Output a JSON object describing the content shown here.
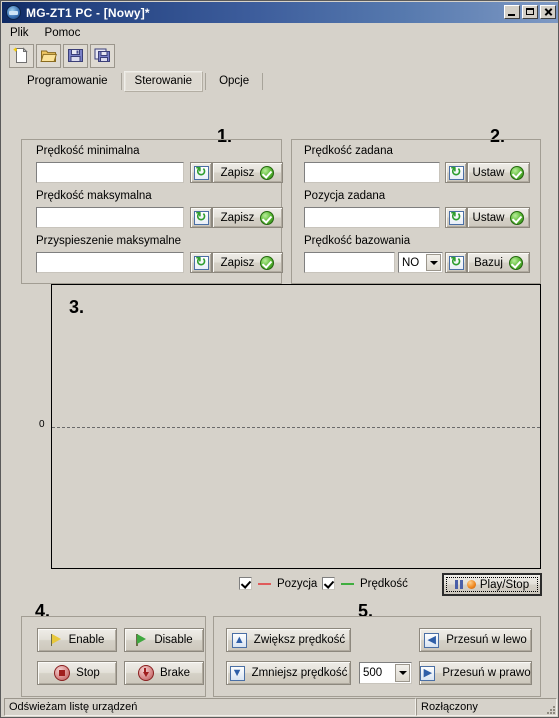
{
  "window": {
    "title": "MG-ZT1 PC  -  [Nowy]*",
    "icon": "app-logo-icon",
    "controls": {
      "minimize": "minimize-icon",
      "maximize": "maximize-icon",
      "close": "close-icon"
    }
  },
  "menu": {
    "items": [
      "Plik",
      "Pomoc"
    ]
  },
  "toolbar": {
    "buttons": [
      {
        "name": "new-file-icon",
        "tooltip": "Nowy"
      },
      {
        "name": "open-file-icon",
        "tooltip": "Otwórz"
      },
      {
        "name": "save-file-icon",
        "tooltip": "Zapisz"
      },
      {
        "name": "save-as-file-icon",
        "tooltip": "Zapisz jako"
      }
    ]
  },
  "tabs": [
    {
      "label": "Programowanie",
      "active": false
    },
    {
      "label": "Sterowanie",
      "active": true
    },
    {
      "label": "Opcje",
      "active": false
    }
  ],
  "group1": {
    "number": "1.",
    "fields": [
      {
        "label": "Prędkość minimalna",
        "value": "",
        "button": "Zapisz"
      },
      {
        "label": "Prędkość maksymalna",
        "value": "",
        "button": "Zapisz"
      },
      {
        "label": "Przyspieszenie maksymalne",
        "value": "",
        "button": "Zapisz"
      }
    ]
  },
  "group2": {
    "number": "2.",
    "fields": [
      {
        "label": "Prędkość zadana",
        "value": "",
        "button": "Ustaw"
      },
      {
        "label": "Pozycja zadana",
        "value": "",
        "button": "Ustaw"
      },
      {
        "label": "Prędkość bazowania",
        "value": "",
        "button": "Bazuj",
        "combo": "NO"
      }
    ]
  },
  "chart": {
    "number": "3.",
    "zero_label": "0"
  },
  "chart_data": {
    "type": "line",
    "title": "",
    "xlabel": "",
    "ylabel": "",
    "grid": true,
    "legend_position": "bottom",
    "yticks": [
      "0"
    ],
    "series": [
      {
        "name": "Pozycja",
        "color": "#e05b5b",
        "visible": true,
        "x": [],
        "values": []
      },
      {
        "name": "Prędkość",
        "color": "#3fae3f",
        "visible": true,
        "x": [],
        "values": []
      }
    ]
  },
  "legend": {
    "items": [
      {
        "label": "Pozycja",
        "color": "#e05b5b",
        "checked": true
      },
      {
        "label": "Prędkość",
        "color": "#3fae3f",
        "checked": true
      }
    ],
    "play_stop": "Play/Stop"
  },
  "group4": {
    "number": "4.",
    "buttons": [
      {
        "label": "Enable",
        "icon": "flag-yellow-icon"
      },
      {
        "label": "Disable",
        "icon": "flag-green-icon"
      },
      {
        "label": "Stop",
        "icon": "stop-circle-icon"
      },
      {
        "label": "Brake",
        "icon": "brake-circle-icon"
      }
    ]
  },
  "group5": {
    "number": "5.",
    "buttons": [
      {
        "label": "Zwiększ prędkość",
        "icon": "arrow-up-icon"
      },
      {
        "label": "Zmniejsz prędkość",
        "icon": "arrow-down-icon"
      },
      {
        "label": "Przesuń w lewo",
        "icon": "arrow-left-icon"
      },
      {
        "label": "Przesuń w prawo",
        "icon": "arrow-right-icon"
      }
    ],
    "step_combo": "500"
  },
  "status": {
    "left": "Odświeżam listę urządzeń",
    "right": "Rozłączony"
  }
}
